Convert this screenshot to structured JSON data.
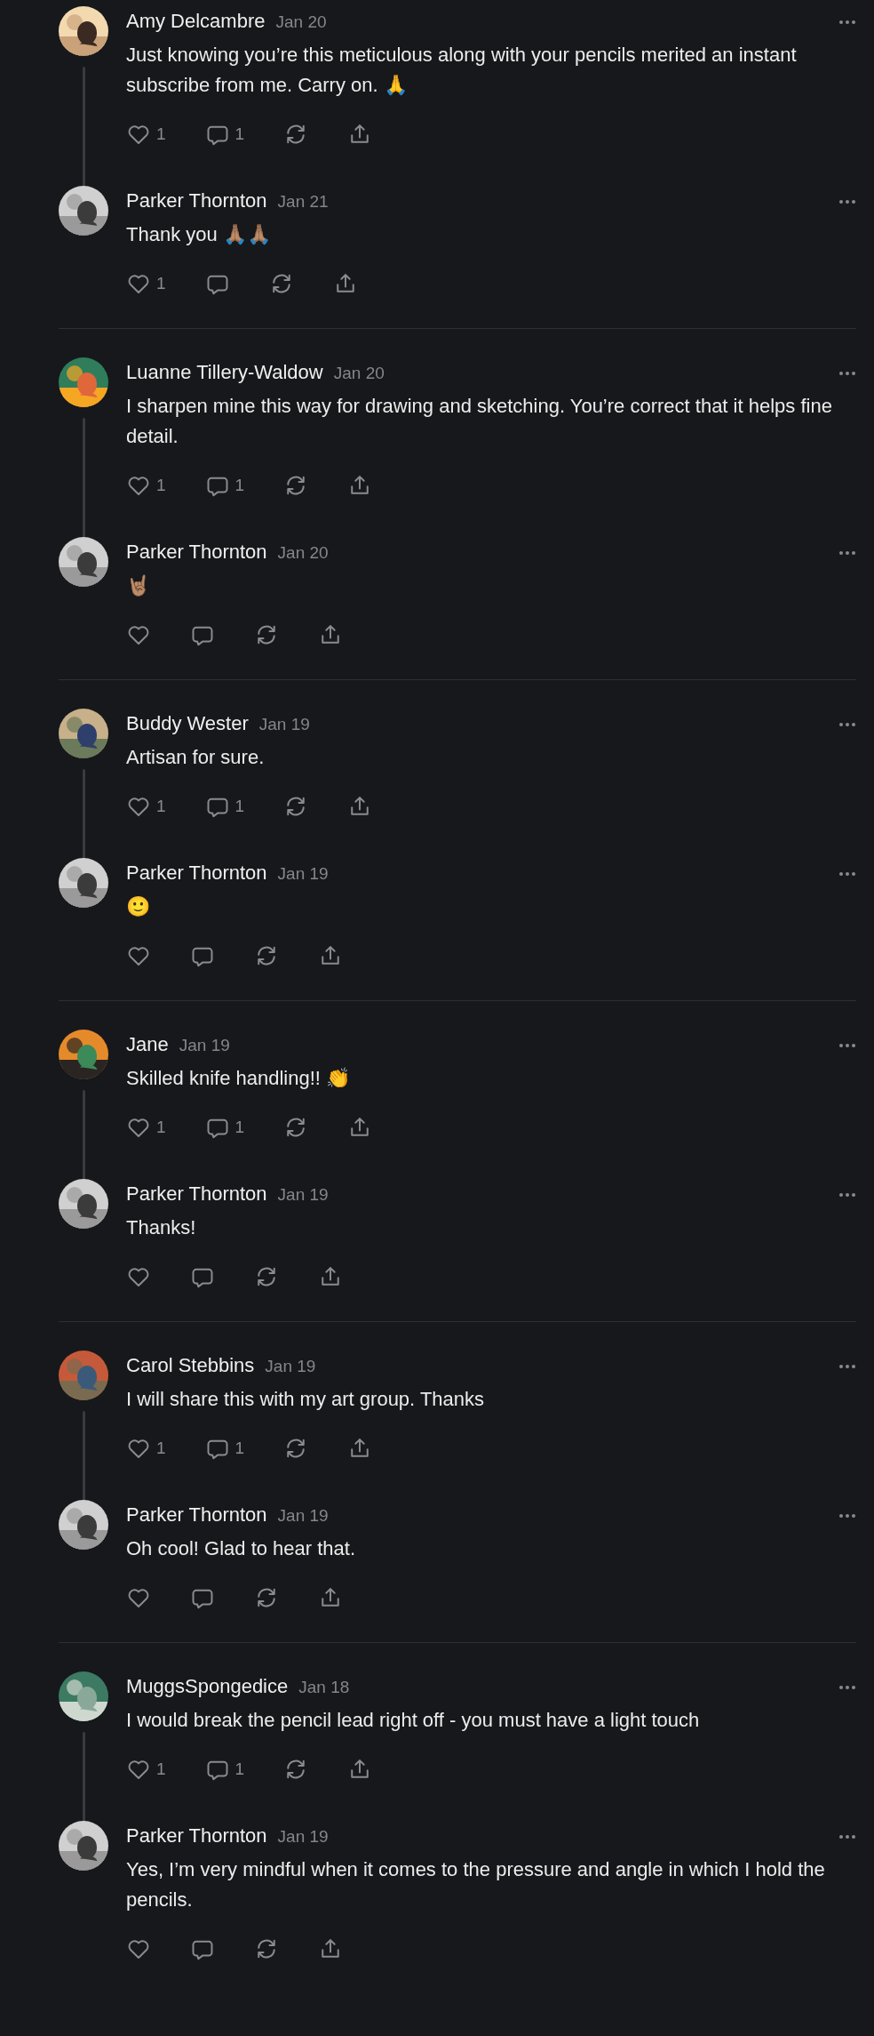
{
  "threads": [
    {
      "comments": [
        {
          "author": "Amy Delcambre",
          "date": "Jan 20",
          "text": "Just knowing you’re this meticulous along with your pencils merited an instant subscribe from me. Carry on. 🙏",
          "likes": "1",
          "replies": "1"
        },
        {
          "author": "Parker Thornton",
          "date": "Jan 21",
          "text": "Thank you 🙏🏽🙏🏽",
          "likes": "1"
        }
      ]
    },
    {
      "comments": [
        {
          "author": "Luanne Tillery-Waldow",
          "date": "Jan 20",
          "text": "I sharpen mine this way for drawing and sketching. You’re correct that it helps fine detail.",
          "likes": "1",
          "replies": "1"
        },
        {
          "author": "Parker Thornton",
          "date": "Jan 20",
          "text": "🤘🏽"
        }
      ]
    },
    {
      "comments": [
        {
          "author": "Buddy Wester",
          "date": "Jan 19",
          "text": "Artisan for sure.",
          "likes": "1",
          "replies": "1"
        },
        {
          "author": "Parker Thornton",
          "date": "Jan 19",
          "text": "🙂"
        }
      ]
    },
    {
      "comments": [
        {
          "author": "Jane",
          "date": "Jan 19",
          "text": "Skilled knife handling!! 👏",
          "likes": "1",
          "replies": "1"
        },
        {
          "author": "Parker Thornton",
          "date": "Jan 19",
          "text": "Thanks!"
        }
      ]
    },
    {
      "comments": [
        {
          "author": "Carol Stebbins",
          "date": "Jan 19",
          "text": "I will share this with my art group. Thanks",
          "likes": "1",
          "replies": "1"
        },
        {
          "author": "Parker Thornton",
          "date": "Jan 19",
          "text": "Oh cool! Glad to hear that."
        }
      ]
    },
    {
      "comments": [
        {
          "author": "MuggsSpongedice",
          "date": "Jan 18",
          "text": "I would break the pencil lead right off - you must have a light touch",
          "likes": "1",
          "replies": "1"
        },
        {
          "author": "Parker Thornton",
          "date": "Jan 19",
          "text": "Yes, I’m very mindful when it comes to the pressure and angle in which I hold the pencils."
        }
      ]
    }
  ]
}
